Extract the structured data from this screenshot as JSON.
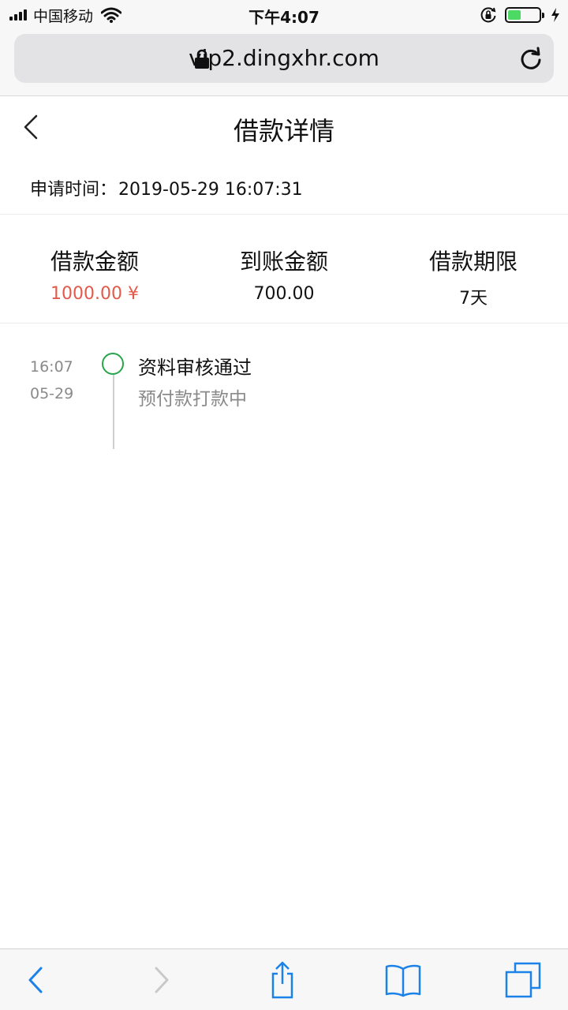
{
  "status_bar": {
    "carrier": "中国移动",
    "time": "下午4:07"
  },
  "browser": {
    "url": "vip2.dingxhr.com"
  },
  "page": {
    "title": "借款详情",
    "apply_time_label": "申请时间：",
    "apply_time_value": "2019-05-29 16:07:31"
  },
  "summary": [
    {
      "label": "借款金额",
      "value": "1000.00 ¥",
      "color": "#e35a4a"
    },
    {
      "label": "到账金额",
      "value": "700.00"
    },
    {
      "label": "借款期限",
      "value": "7天"
    }
  ],
  "timeline": [
    {
      "time": "16:07",
      "date": "05-29",
      "title": "资料审核通过",
      "description": "预付款打款中",
      "status_color": "#2aa44a"
    }
  ],
  "toolbar": {
    "icons": [
      "back-icon",
      "forward-icon",
      "share-icon",
      "bookmarks-icon",
      "tabs-icon"
    ],
    "accent": "#1a82e8"
  }
}
